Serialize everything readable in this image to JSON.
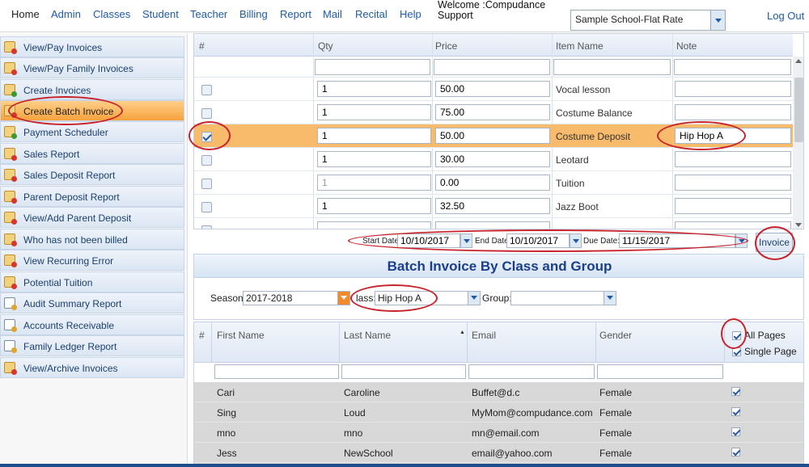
{
  "nav": {
    "items": [
      "Home",
      "Admin",
      "Classes",
      "Student",
      "Teacher",
      "Billing",
      "Report",
      "Mail",
      "Recital",
      "Help"
    ],
    "welcome_line1": "Welcome :Compudance",
    "welcome_line2": "Support",
    "school": "Sample School-Flat Rate",
    "logout": "Log Out"
  },
  "sidebar": {
    "items": [
      "View/Pay Invoices",
      "View/Pay Family Invoices",
      "Create Invoices",
      "Create Batch Invoice",
      "Payment Scheduler",
      "Sales Report",
      "Sales Deposit Report",
      "Parent Deposit Report",
      "View/Add Parent Deposit",
      "Who has not been billed",
      "View Recurring Error",
      "Potential Tuition",
      "Audit Summary Report",
      "Accounts Receivable",
      "Family Ledger Report",
      "View/Archive Invoices"
    ],
    "active": "Create Batch Invoice"
  },
  "invoice_grid": {
    "headers": [
      "#",
      "Qty",
      "Price",
      "Item Name",
      "Note"
    ],
    "rows": [
      {
        "qty": "1",
        "price": "50.00",
        "item": "Vocal lesson",
        "note": "",
        "checked": false
      },
      {
        "qty": "1",
        "price": "75.00",
        "item": "Costume Balance",
        "note": "",
        "checked": false
      },
      {
        "qty": "1",
        "price": "50.00",
        "item": "Costume Deposit",
        "note": "Hip Hop A",
        "checked": true
      },
      {
        "qty": "1",
        "price": "30.00",
        "item": "Leotard",
        "note": "",
        "checked": false
      },
      {
        "qty": "1",
        "price": "0.00",
        "item": "Tuition",
        "note": "",
        "checked": false
      },
      {
        "qty": "1",
        "price": "32.50",
        "item": "Jazz Boot",
        "note": "",
        "checked": false
      }
    ]
  },
  "dates": {
    "start_label": "Start Date",
    "start_value": "10/10/2017",
    "end_label": "End Date",
    "end_value": "10/10/2017",
    "due_label": "Due Date:",
    "due_value": "11/15/2017",
    "invoice_button": "Invoice"
  },
  "batch": {
    "title": "Batch Invoice By Class and Group",
    "season_label": "Season:",
    "season_value": "2017-2018",
    "class_label": "lass:",
    "class_value": "Hip Hop A",
    "group_label": "Group:",
    "group_value": ""
  },
  "students": {
    "headers": [
      "#",
      "First Name",
      "Last Name",
      "Email",
      "Gender"
    ],
    "all_pages": "All Pages",
    "single_page": "Single Page",
    "rows": [
      {
        "first": "Cari",
        "last": "Caroline",
        "email": "Buffet@d.c",
        "gender": "Female"
      },
      {
        "first": "Sing",
        "last": "Loud",
        "email": "MyMom@compudance.com",
        "gender": "Female"
      },
      {
        "first": "mno",
        "last": "mno",
        "email": "mn@email.com",
        "gender": "Female"
      },
      {
        "first": "Jess",
        "last": "NewSchool",
        "email": "email@yahoo.com",
        "gender": "Female"
      }
    ]
  }
}
